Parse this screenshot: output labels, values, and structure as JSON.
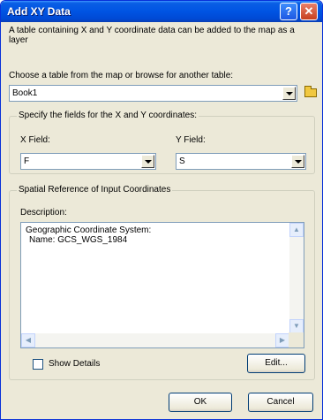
{
  "window": {
    "title": "Add XY Data",
    "help_label": "?",
    "close_label": "✕"
  },
  "intro_text": "A table containing X and Y coordinate data can be added to the map as a layer",
  "table_select": {
    "label": "Choose a table from the map or browse for another table:",
    "value": "Book1",
    "browse_icon": "open-folder-icon"
  },
  "fields_group": {
    "label": "Specify the fields for the X and Y coordinates:",
    "x_label": "X Field:",
    "x_value": "F",
    "y_label": "Y Field:",
    "y_value": "S"
  },
  "spatial_group": {
    "label": "Spatial Reference of Input Coordinates",
    "description_label": "Description:",
    "description_lines": [
      "Geographic Coordinate System:",
      "  Name: GCS_WGS_1984"
    ],
    "show_details_label": "Show Details",
    "show_details_checked": false,
    "edit_label": "Edit..."
  },
  "buttons": {
    "ok": "OK",
    "cancel": "Cancel"
  }
}
